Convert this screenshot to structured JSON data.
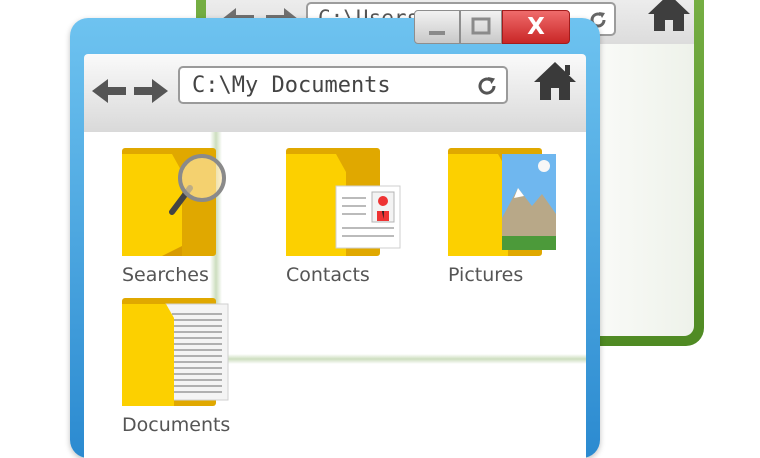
{
  "back_window": {
    "address": "C:\\Users"
  },
  "front_window": {
    "address": "C:\\My Documents",
    "close_label": "X"
  },
  "folders": [
    {
      "label": "Searches"
    },
    {
      "label": "Contacts"
    },
    {
      "label": "Pictures"
    },
    {
      "label": "Documents"
    }
  ],
  "colors": {
    "front_frame": "#3a9ee0",
    "back_frame": "#5f9a2f",
    "folder": "#f7c600",
    "close": "#d83333"
  }
}
